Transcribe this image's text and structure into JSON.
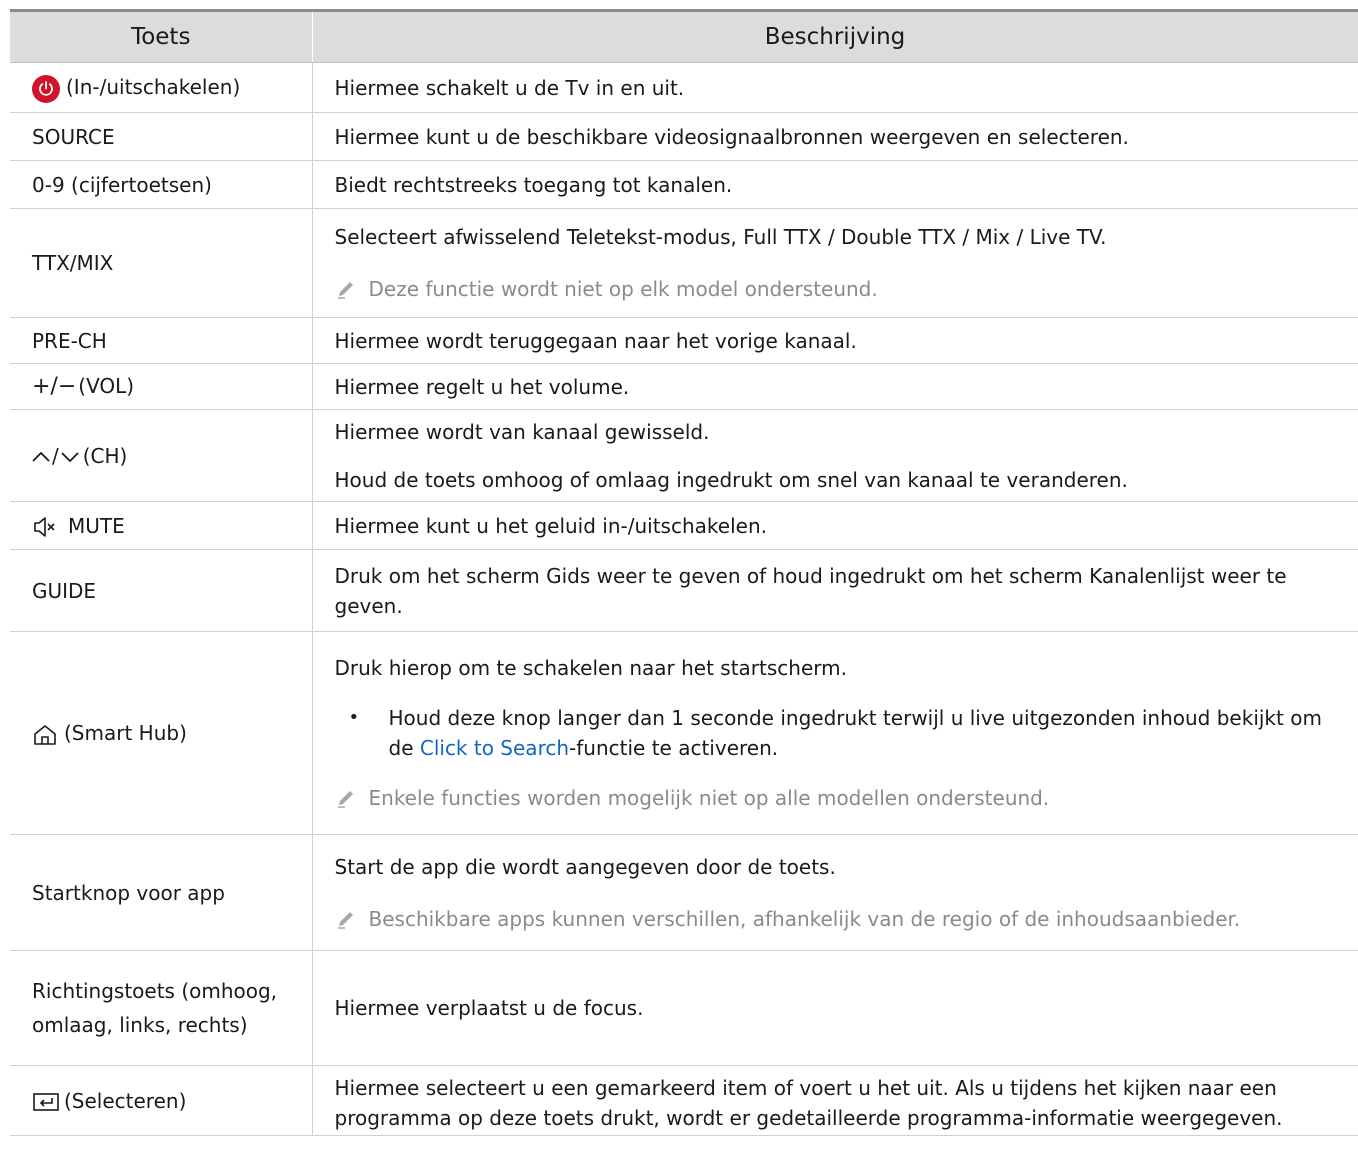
{
  "header": {
    "col_key": "Toets",
    "col_desc": "Beschrijving"
  },
  "rows": [
    {
      "key": "(In-/uitschakelen)",
      "desc": [
        "Hiermee schakelt u de Tv in en uit."
      ]
    },
    {
      "key": "SOURCE",
      "desc": [
        "Hiermee kunt u de beschikbare videosignaalbronnen weergeven en selecteren."
      ]
    },
    {
      "key": "0-9 (cijfertoetsen)",
      "desc": [
        "Biedt rechtstreeks toegang tot kanalen."
      ]
    },
    {
      "key": "TTX/MIX",
      "desc": [
        "Selecteert afwisselend Teletekst-modus, Full TTX / Double TTX / Mix / Live TV."
      ],
      "note": "Deze functie wordt niet op elk model ondersteund."
    },
    {
      "key": "PRE-CH",
      "desc": [
        "Hiermee wordt teruggegaan naar het vorige kanaal."
      ]
    },
    {
      "key": "(VOL)",
      "desc": [
        "Hiermee regelt u het volume."
      ]
    },
    {
      "key": "(CH)",
      "desc": [
        "Hiermee wordt van kanaal gewisseld.",
        "Houd de toets omhoog of omlaag ingedrukt om snel van kanaal te veranderen."
      ]
    },
    {
      "key": "MUTE",
      "desc": [
        "Hiermee kunt u het geluid in-/uitschakelen."
      ]
    },
    {
      "key": "GUIDE",
      "desc": [
        "Druk om het scherm Gids weer te geven of houd ingedrukt om het scherm Kanalenlijst weer te geven."
      ]
    },
    {
      "key": "(Smart Hub)",
      "desc": [
        "Druk hierop om te schakelen naar het startscherm."
      ],
      "bullet_pre": "Houd deze knop langer dan 1 seconde ingedrukt terwijl u live uitgezonden inhoud bekijkt om de ",
      "bullet_link": "Click to Search",
      "bullet_post": "-functie te activeren.",
      "note": "Enkele functies worden mogelijk niet op alle modellen ondersteund."
    },
    {
      "key": "Startknop voor app",
      "desc": [
        "Start de app die wordt aangegeven door de toets."
      ],
      "note": "Beschikbare apps kunnen verschillen, afhankelijk van de regio of de inhoudsaanbieder."
    },
    {
      "key": "Richtingstoets (omhoog, omlaag, links, rechts)",
      "desc": [
        "Hiermee verplaatst u de focus."
      ]
    },
    {
      "key": "(Selecteren)",
      "desc": [
        "Hiermee selecteert u een gemarkeerd item of voert u het uit. Als u tijdens het kijken naar een programma op deze toets drukt, wordt er gedetailleerde programma-informatie weergegeven."
      ]
    }
  ],
  "bullet_symbol": "•",
  "vol_symbols": "+/−",
  "ch_separator": "/",
  "colors": {
    "header_bg": "#dcdcdc",
    "link": "#1565c0",
    "power": "#d0132a",
    "note": "#8a8a8a"
  },
  "icons": [
    "power-icon",
    "plus-minus-icon",
    "chevron-up-icon",
    "chevron-down-icon",
    "mute-icon",
    "home-icon",
    "enter-icon",
    "pencil-note-icon"
  ]
}
